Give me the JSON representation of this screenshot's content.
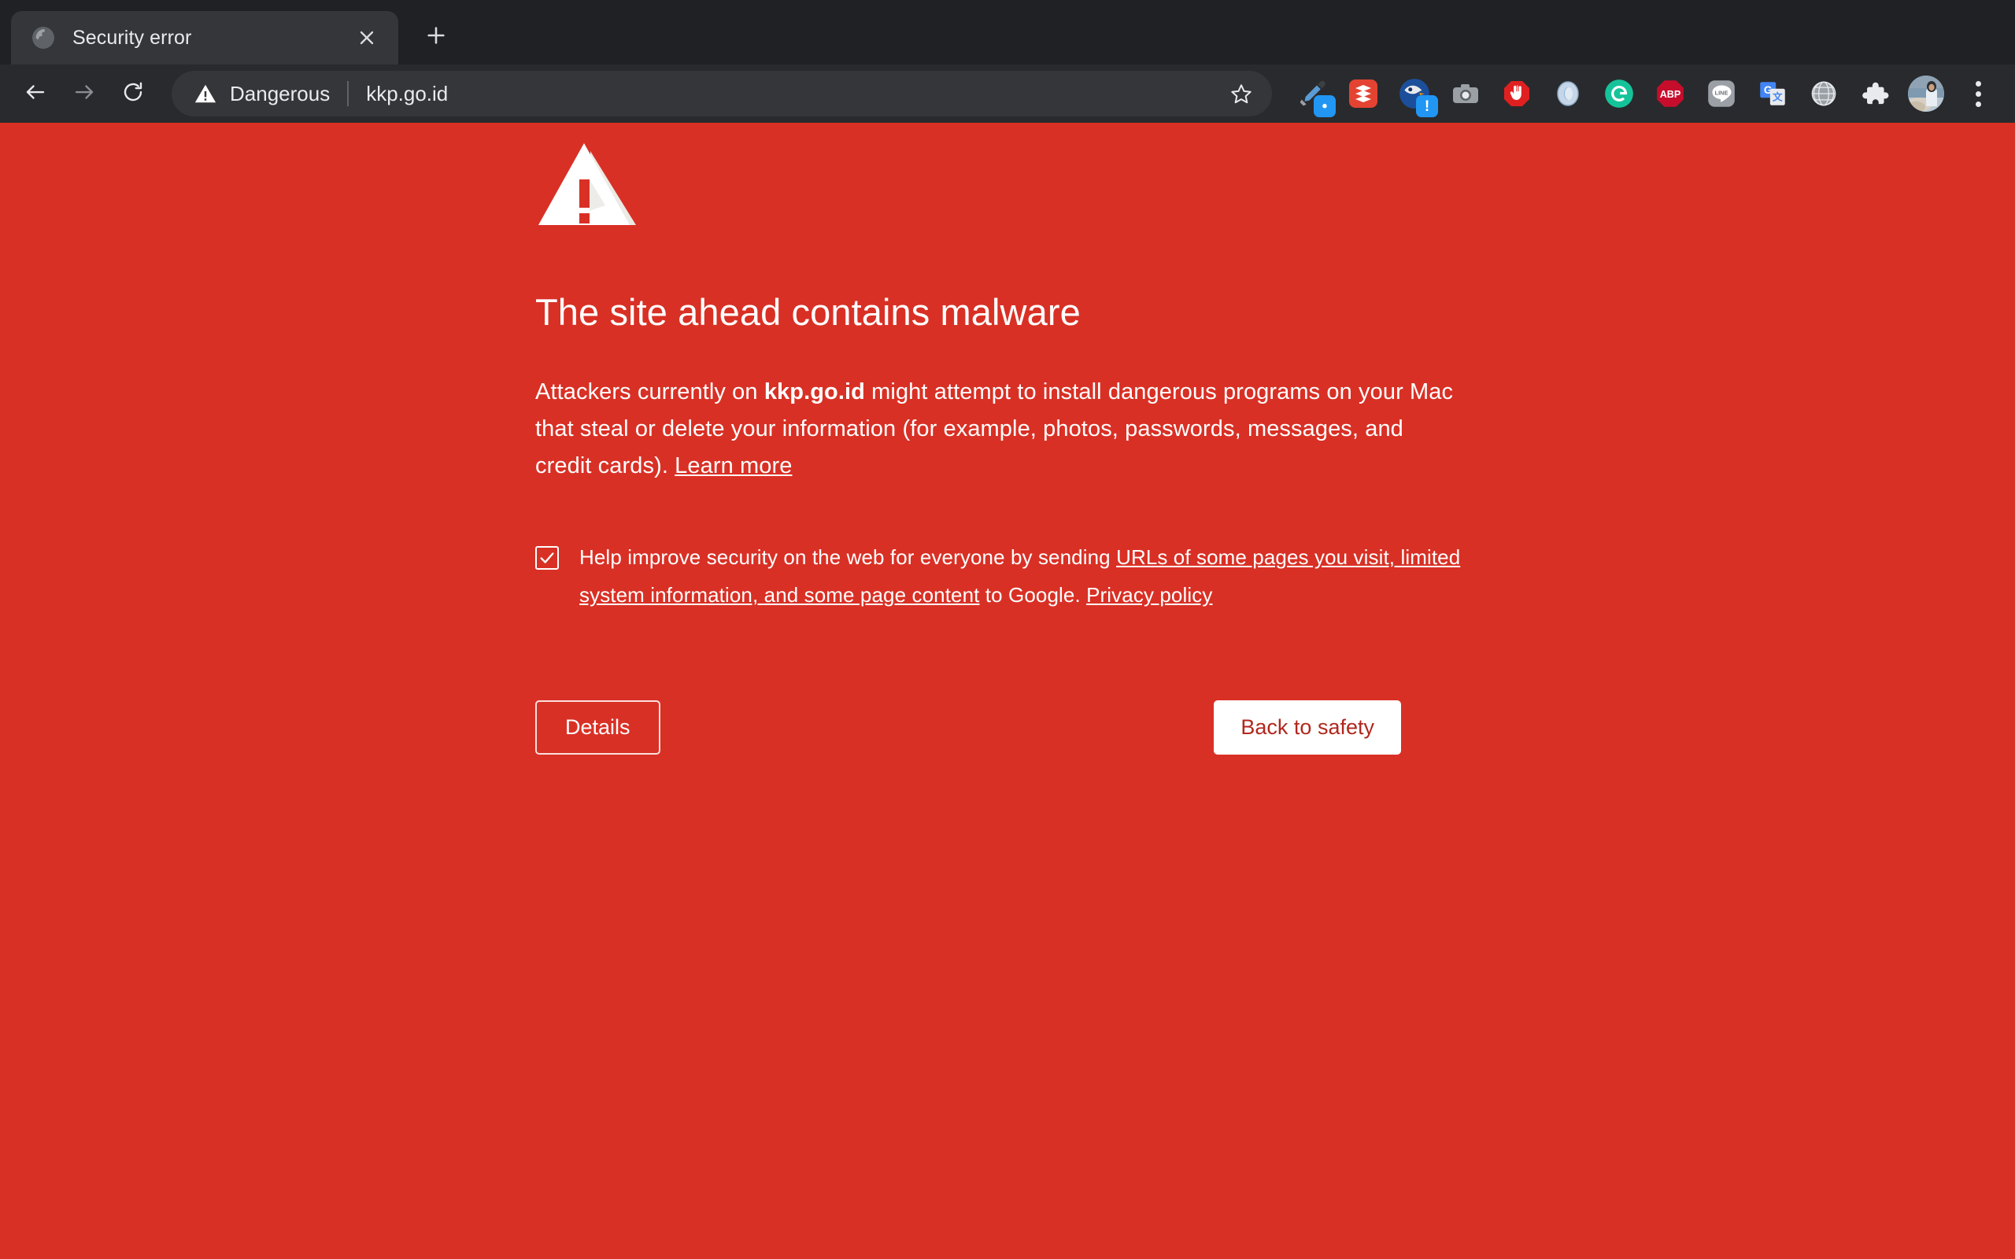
{
  "browser": {
    "tab": {
      "title": "Security error",
      "favicon_icon": "globe-icon",
      "close_icon": "close-icon"
    },
    "new_tab_icon": "plus-icon",
    "nav": {
      "back_icon": "back-arrow-icon",
      "forward_icon": "forward-arrow-icon",
      "reload_icon": "reload-icon"
    },
    "omnibox": {
      "security_label": "Dangerous",
      "security_icon": "warning-triangle-icon",
      "url": "kkp.go.id",
      "bookmark_icon": "star-icon"
    },
    "extensions": [
      {
        "name": "eyedropper-extension-icon",
        "label": "",
        "badge": "•"
      },
      {
        "name": "todoist-extension-icon",
        "label": "",
        "badge": ""
      },
      {
        "name": "thunderbird-extension-icon",
        "label": "",
        "badge": "!"
      },
      {
        "name": "camera-extension-icon",
        "label": "",
        "badge": ""
      },
      {
        "name": "stop-hand-extension-icon",
        "label": "",
        "badge": ""
      },
      {
        "name": "blue-ring-extension-icon",
        "label": "",
        "badge": ""
      },
      {
        "name": "grammarly-extension-icon",
        "label": "G",
        "badge": ""
      },
      {
        "name": "adblock-plus-extension-icon",
        "label": "ABP",
        "badge": ""
      },
      {
        "name": "line-extension-icon",
        "label": "LINE",
        "badge": ""
      },
      {
        "name": "google-translate-extension-icon",
        "label": "G",
        "badge": ""
      },
      {
        "name": "globe-extension-icon",
        "label": "",
        "badge": ""
      },
      {
        "name": "extensions-puzzle-icon",
        "label": "",
        "badge": ""
      }
    ],
    "profile_avatar_icon": "avatar",
    "menu_icon": "three-dot-menu-icon"
  },
  "interstitial": {
    "warning_icon": "warning-triangle-icon",
    "title": "The site ahead contains malware",
    "body": {
      "before_site": "Attackers currently on ",
      "site": "kkp.go.id",
      "after_site": " might attempt to install dangerous programs on your Mac that steal or delete your information (for example, photos, passwords, messages, and credit cards). ",
      "learn_more": "Learn more"
    },
    "optin": {
      "checked": true,
      "part1": "Help improve security on the web for everyone by sending ",
      "link1": "URLs of some pages you visit, limited system information, and some page content",
      "part2": " to Google. ",
      "link2": "Privacy policy"
    },
    "buttons": {
      "details": "Details",
      "back_to_safety": "Back to safety"
    },
    "colors": {
      "background": "#d93025",
      "button_text": "#b1271d",
      "text": "#ffffff"
    }
  }
}
